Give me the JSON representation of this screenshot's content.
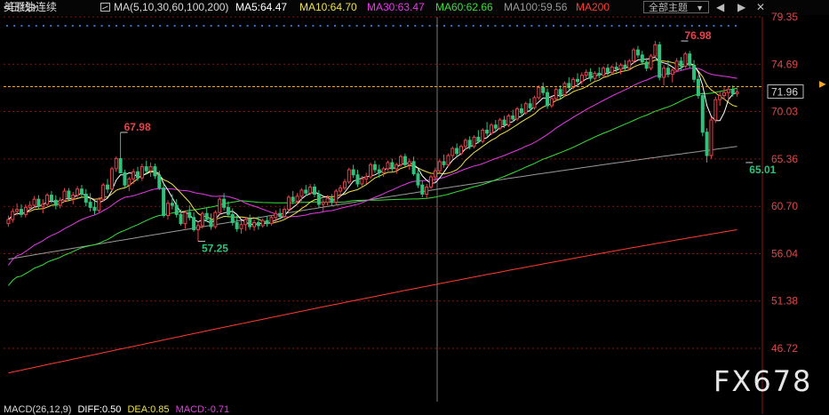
{
  "header": {
    "title": "美原油连续",
    "period": "<日线>",
    "ma_label": "MA(5,10,30,60,100,200)",
    "ma5": "MA5:64.47",
    "ma10": "MA10:64.70",
    "ma30": "MA30:63.47",
    "ma60": "MA60:62.66",
    "ma100": "MA100:59.56",
    "ma200": "MA200",
    "theme_button": "全部主题",
    "nav_prev": "◀",
    "nav_next": "▶",
    "close": "✕"
  },
  "colors": {
    "up": "#e8434b",
    "down": "#2ec27a",
    "ma5": "#ffffff",
    "ma10": "#f0e24a",
    "ma30": "#e83ae8",
    "ma60": "#39e03a",
    "ma100": "#9a9a9a",
    "ma200": "#ff3b2f",
    "grid": "#8a1313",
    "crosshair": "#777777",
    "price_line": "#f5a623",
    "axis_text": "#e04848",
    "dots": "#2f74c6"
  },
  "current_price": "71.96",
  "watermark": "FX678",
  "macd": {
    "label": "MACD(26,12,9)",
    "diff": "DIFF:0.50",
    "dea": "DEA:0.85",
    "macd": "MACD:-0.71"
  },
  "chart_data": {
    "type": "candlestick",
    "y_axis": {
      "ticks": [
        79.35,
        74.69,
        70.03,
        65.36,
        60.7,
        56.04,
        51.38,
        46.72
      ],
      "range": [
        42.3,
        80.2
      ]
    },
    "annotations": [
      {
        "label": "67.98",
        "bar": 26,
        "value": 67.98,
        "type": "high"
      },
      {
        "label": "57.25",
        "bar": 44,
        "value": 57.25,
        "type": "low"
      },
      {
        "label": "76.98",
        "bar": 156,
        "value": 76.98,
        "type": "high"
      },
      {
        "label": "65.01",
        "bar": 171,
        "value": 65.01,
        "type": "low"
      }
    ],
    "ohlc": [
      [
        59.0,
        59.8,
        58.7,
        59.4
      ],
      [
        59.4,
        60.5,
        59.1,
        60.2
      ],
      [
        60.2,
        61.0,
        59.8,
        60.4
      ],
      [
        60.4,
        60.9,
        59.6,
        59.9
      ],
      [
        59.9,
        60.9,
        59.6,
        60.6
      ],
      [
        60.6,
        61.2,
        60.1,
        60.8
      ],
      [
        60.8,
        61.7,
        60.6,
        61.4
      ],
      [
        61.4,
        61.8,
        60.4,
        60.7
      ],
      [
        60.7,
        61.4,
        60.0,
        60.9
      ],
      [
        60.9,
        62.0,
        60.7,
        61.8
      ],
      [
        61.8,
        62.2,
        61.0,
        61.3
      ],
      [
        61.3,
        61.8,
        60.4,
        60.8
      ],
      [
        60.8,
        61.6,
        60.5,
        61.3
      ],
      [
        61.3,
        62.5,
        61.1,
        62.2
      ],
      [
        62.2,
        62.5,
        61.3,
        61.5
      ],
      [
        61.5,
        62.1,
        60.9,
        61.8
      ],
      [
        61.8,
        62.7,
        61.5,
        62.4
      ],
      [
        62.4,
        62.8,
        61.6,
        61.9
      ],
      [
        61.9,
        62.4,
        60.7,
        61.1
      ],
      [
        61.1,
        62.0,
        60.2,
        60.6
      ],
      [
        60.6,
        61.2,
        59.9,
        60.3
      ],
      [
        60.3,
        61.6,
        60.1,
        61.4
      ],
      [
        61.4,
        63.0,
        61.2,
        62.8
      ],
      [
        62.8,
        63.4,
        62.0,
        62.4
      ],
      [
        62.4,
        64.6,
        62.2,
        64.4
      ],
      [
        64.4,
        65.6,
        64.1,
        65.4
      ],
      [
        65.4,
        67.98,
        64.8,
        64.0
      ],
      [
        64.0,
        64.3,
        62.6,
        62.8
      ],
      [
        62.8,
        63.6,
        62.2,
        63.4
      ],
      [
        63.4,
        64.4,
        62.9,
        64.1
      ],
      [
        64.1,
        64.6,
        63.2,
        63.5
      ],
      [
        63.5,
        64.9,
        63.2,
        64.6
      ],
      [
        64.6,
        65.2,
        63.9,
        64.2
      ],
      [
        64.2,
        65.0,
        63.6,
        64.6
      ],
      [
        64.6,
        64.9,
        63.4,
        63.7
      ],
      [
        63.7,
        64.2,
        62.3,
        62.5
      ],
      [
        62.5,
        62.9,
        59.6,
        59.8
      ],
      [
        59.8,
        61.3,
        59.4,
        61.0
      ],
      [
        61.0,
        61.9,
        60.4,
        60.8
      ],
      [
        60.8,
        61.4,
        59.6,
        59.9
      ],
      [
        59.9,
        60.4,
        58.8,
        59.0
      ],
      [
        59.0,
        60.3,
        58.5,
        60.1
      ],
      [
        60.1,
        60.8,
        59.3,
        59.6
      ],
      [
        59.6,
        60.1,
        58.2,
        58.4
      ],
      [
        58.4,
        59.2,
        57.25,
        58.8
      ],
      [
        58.8,
        60.2,
        58.5,
        60.0
      ],
      [
        60.0,
        60.6,
        59.2,
        59.4
      ],
      [
        59.4,
        60.0,
        58.4,
        58.7
      ],
      [
        58.7,
        60.3,
        58.5,
        60.1
      ],
      [
        60.1,
        61.6,
        59.9,
        61.4
      ],
      [
        61.4,
        62.0,
        60.3,
        60.6
      ],
      [
        60.6,
        61.2,
        59.6,
        59.9
      ],
      [
        59.9,
        60.5,
        58.8,
        59.1
      ],
      [
        59.1,
        59.8,
        58.2,
        58.5
      ],
      [
        58.5,
        59.3,
        58.0,
        58.9
      ],
      [
        58.9,
        59.6,
        58.3,
        59.4
      ],
      [
        59.4,
        59.9,
        58.4,
        58.7
      ],
      [
        58.7,
        59.4,
        58.3,
        59.1
      ],
      [
        59.1,
        59.7,
        58.4,
        58.8
      ],
      [
        58.8,
        59.5,
        58.6,
        59.3
      ],
      [
        59.3,
        59.7,
        58.7,
        59.0
      ],
      [
        59.0,
        59.8,
        58.8,
        59.6
      ],
      [
        59.6,
        60.3,
        59.2,
        60.0
      ],
      [
        60.0,
        60.5,
        59.4,
        59.7
      ],
      [
        59.7,
        60.6,
        59.5,
        60.4
      ],
      [
        60.4,
        61.8,
        60.2,
        61.6
      ],
      [
        61.6,
        62.2,
        60.9,
        61.2
      ],
      [
        61.2,
        62.0,
        60.9,
        61.7
      ],
      [
        61.7,
        62.5,
        61.2,
        62.3
      ],
      [
        62.3,
        62.8,
        61.7,
        62.0
      ],
      [
        62.0,
        62.9,
        61.8,
        62.6
      ],
      [
        62.6,
        62.9,
        61.6,
        61.9
      ],
      [
        61.9,
        62.3,
        60.6,
        60.9
      ],
      [
        60.9,
        61.4,
        60.2,
        61.1
      ],
      [
        61.1,
        61.8,
        60.8,
        61.5
      ],
      [
        61.5,
        61.9,
        60.8,
        61.1
      ],
      [
        61.1,
        62.4,
        60.9,
        62.2
      ],
      [
        62.2,
        62.8,
        61.6,
        62.5
      ],
      [
        62.5,
        63.4,
        62.3,
        63.1
      ],
      [
        63.1,
        64.5,
        62.9,
        64.3
      ],
      [
        64.3,
        64.8,
        63.5,
        63.8
      ],
      [
        63.8,
        64.3,
        62.6,
        62.9
      ],
      [
        62.9,
        63.7,
        62.6,
        63.4
      ],
      [
        63.4,
        64.0,
        62.9,
        63.6
      ],
      [
        63.6,
        65.0,
        63.4,
        64.8
      ],
      [
        64.8,
        65.2,
        64.0,
        64.3
      ],
      [
        64.3,
        64.8,
        63.5,
        64.0
      ],
      [
        64.0,
        64.6,
        63.6,
        64.4
      ],
      [
        64.4,
        65.2,
        64.2,
        65.0
      ],
      [
        65.0,
        65.4,
        64.1,
        64.4
      ],
      [
        64.4,
        65.0,
        63.9,
        64.8
      ],
      [
        64.8,
        65.8,
        64.6,
        65.6
      ],
      [
        65.6,
        65.9,
        64.6,
        64.8
      ],
      [
        64.8,
        65.4,
        64.3,
        65.1
      ],
      [
        65.1,
        65.6,
        63.7,
        63.9
      ],
      [
        63.9,
        64.3,
        62.5,
        62.8
      ],
      [
        62.8,
        63.2,
        61.6,
        61.9
      ],
      [
        61.9,
        62.9,
        61.5,
        62.6
      ],
      [
        62.6,
        63.8,
        62.4,
        63.6
      ],
      [
        63.6,
        64.5,
        63.1,
        64.2
      ],
      [
        64.2,
        65.3,
        64.0,
        65.1
      ],
      [
        65.1,
        65.8,
        64.5,
        64.8
      ],
      [
        64.8,
        65.9,
        64.6,
        65.7
      ],
      [
        65.7,
        66.6,
        65.4,
        66.4
      ],
      [
        66.4,
        66.9,
        65.6,
        65.9
      ],
      [
        65.9,
        66.8,
        65.7,
        66.6
      ],
      [
        66.6,
        67.4,
        66.2,
        67.2
      ],
      [
        67.2,
        67.6,
        66.3,
        66.6
      ],
      [
        66.6,
        67.7,
        66.4,
        67.5
      ],
      [
        67.5,
        68.2,
        66.9,
        67.1
      ],
      [
        67.1,
        68.4,
        66.9,
        68.2
      ],
      [
        68.2,
        69.0,
        67.6,
        67.9
      ],
      [
        67.9,
        68.9,
        67.7,
        68.7
      ],
      [
        68.7,
        69.2,
        68.0,
        68.4
      ],
      [
        68.4,
        69.4,
        68.2,
        69.2
      ],
      [
        69.2,
        69.6,
        68.4,
        68.7
      ],
      [
        68.7,
        69.8,
        68.5,
        69.6
      ],
      [
        69.6,
        70.2,
        69.0,
        69.3
      ],
      [
        69.3,
        70.5,
        69.1,
        70.3
      ],
      [
        70.3,
        70.8,
        69.5,
        69.9
      ],
      [
        69.9,
        71.0,
        69.7,
        70.8
      ],
      [
        70.8,
        71.3,
        70.0,
        70.4
      ],
      [
        70.4,
        71.6,
        70.2,
        71.4
      ],
      [
        71.4,
        72.6,
        71.2,
        72.4
      ],
      [
        72.4,
        72.9,
        71.6,
        71.9
      ],
      [
        71.9,
        72.3,
        70.3,
        70.6
      ],
      [
        70.6,
        71.5,
        70.4,
        71.3
      ],
      [
        71.3,
        72.4,
        71.1,
        72.2
      ],
      [
        72.2,
        72.6,
        71.3,
        71.7
      ],
      [
        71.7,
        73.0,
        71.5,
        72.8
      ],
      [
        72.8,
        73.4,
        72.1,
        72.4
      ],
      [
        72.4,
        73.4,
        72.2,
        73.2
      ],
      [
        73.2,
        73.8,
        72.6,
        73.0
      ],
      [
        73.0,
        73.9,
        72.7,
        73.6
      ],
      [
        73.6,
        74.2,
        73.2,
        73.9
      ],
      [
        73.9,
        74.3,
        73.0,
        73.3
      ],
      [
        73.3,
        74.0,
        73.1,
        73.8
      ],
      [
        73.8,
        74.4,
        73.3,
        73.6
      ],
      [
        73.6,
        74.5,
        73.4,
        74.3
      ],
      [
        74.3,
        74.7,
        73.6,
        73.9
      ],
      [
        73.9,
        74.6,
        73.7,
        74.4
      ],
      [
        74.4,
        74.9,
        73.9,
        74.2
      ],
      [
        74.2,
        74.8,
        73.7,
        74.6
      ],
      [
        74.6,
        75.1,
        74.0,
        74.3
      ],
      [
        74.3,
        75.2,
        74.1,
        75.0
      ],
      [
        75.0,
        76.3,
        74.8,
        76.1
      ],
      [
        76.1,
        76.5,
        75.3,
        75.6
      ],
      [
        75.6,
        76.0,
        74.6,
        74.9
      ],
      [
        74.9,
        75.3,
        74.0,
        74.3
      ],
      [
        74.3,
        75.7,
        74.1,
        75.5
      ],
      [
        75.5,
        76.98,
        75.3,
        76.6
      ],
      [
        76.6,
        76.9,
        73.1,
        73.4
      ],
      [
        73.4,
        74.6,
        72.6,
        74.3
      ],
      [
        74.3,
        75.1,
        73.4,
        73.7
      ],
      [
        73.7,
        74.3,
        72.9,
        74.1
      ],
      [
        74.1,
        75.3,
        73.9,
        75.0
      ],
      [
        75.0,
        75.4,
        74.1,
        74.5
      ],
      [
        74.5,
        75.9,
        74.3,
        75.7
      ],
      [
        75.7,
        76.0,
        74.3,
        74.6
      ],
      [
        74.6,
        75.1,
        72.9,
        73.2
      ],
      [
        73.2,
        73.6,
        71.3,
        71.6
      ],
      [
        71.6,
        71.9,
        67.6,
        68.0
      ],
      [
        68.0,
        68.4,
        65.01,
        65.7
      ],
      [
        65.7,
        69.5,
        65.4,
        69.2
      ],
      [
        69.2,
        71.5,
        68.9,
        71.2
      ],
      [
        71.2,
        72.0,
        70.6,
        71.6
      ],
      [
        71.6,
        72.4,
        71.2,
        71.9
      ],
      [
        71.9,
        72.5,
        71.1,
        72.2
      ],
      [
        72.2,
        72.6,
        71.5,
        71.8
      ],
      [
        71.8,
        72.4,
        71.5,
        71.96
      ]
    ],
    "moving_averages": [
      {
        "name": "MA100",
        "start": 55.5,
        "end": 66.6
      },
      {
        "name": "MA200",
        "start": 44.3,
        "end": 58.4
      }
    ]
  }
}
